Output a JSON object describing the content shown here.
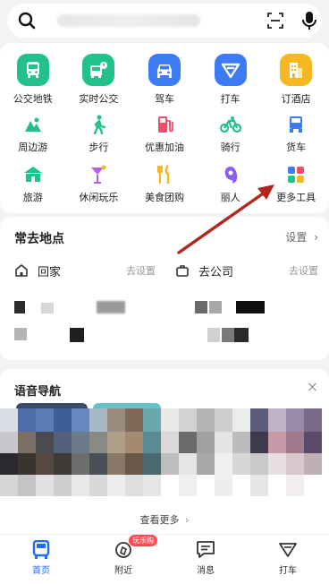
{
  "search": {
    "icons": {
      "search": "search-icon",
      "scan": "scan-icon",
      "voice": "mic-icon"
    }
  },
  "services": {
    "big": [
      {
        "label": "公交地铁",
        "icon": "bus-icon",
        "color": "#22c08a"
      },
      {
        "label": "实时公交",
        "icon": "realtime-bus-icon",
        "color": "#22c08a"
      },
      {
        "label": "驾车",
        "icon": "car-icon",
        "color": "#3c7bf5"
      },
      {
        "label": "打车",
        "icon": "taxi-icon",
        "color": "#3c7bf5"
      },
      {
        "label": "订酒店",
        "icon": "hotel-icon",
        "color": "#f5b820"
      }
    ],
    "row1": [
      {
        "label": "周边游",
        "icon": "nearby-tour-icon",
        "color": "#22c08a"
      },
      {
        "label": "步行",
        "icon": "walk-icon",
        "color": "#22c08a"
      },
      {
        "label": "优惠加油",
        "icon": "fuel-icon",
        "color": "#ef4d6a"
      },
      {
        "label": "骑行",
        "icon": "bike-icon",
        "color": "#22c08a"
      },
      {
        "label": "货车",
        "icon": "truck-icon",
        "color": "#3c7bf5"
      }
    ],
    "row2": [
      {
        "label": "旅游",
        "icon": "travel-icon",
        "color": "#22c08a"
      },
      {
        "label": "休闲玩乐",
        "icon": "leisure-icon",
        "color": "#b560e8"
      },
      {
        "label": "美食团购",
        "icon": "food-icon",
        "color": "#f5b820"
      },
      {
        "label": "丽人",
        "icon": "beauty-icon",
        "color": "#8a5cf0"
      },
      {
        "label": "更多工具",
        "icon": "more-tools-icon",
        "color": "#3c7bf5"
      }
    ]
  },
  "places": {
    "title": "常去地点",
    "settings": "设置",
    "home": {
      "name": "回家",
      "action": "去设置"
    },
    "work": {
      "name": "去公司",
      "action": "去设置"
    }
  },
  "voice_nav": {
    "title": "语音导航",
    "close": "×",
    "more": "查看更多"
  },
  "tabbar": {
    "tabs": [
      {
        "label": "首页",
        "icon": "home-bus-icon",
        "active": true
      },
      {
        "label": "附近",
        "icon": "nearby-icon",
        "badge": "玩乐购"
      },
      {
        "label": "消息",
        "icon": "message-icon"
      },
      {
        "label": "打车",
        "icon": "taxi-tab-icon"
      }
    ]
  },
  "colors": {
    "accent": "#1f6bff",
    "annotation_arrow": "#b3261e"
  }
}
